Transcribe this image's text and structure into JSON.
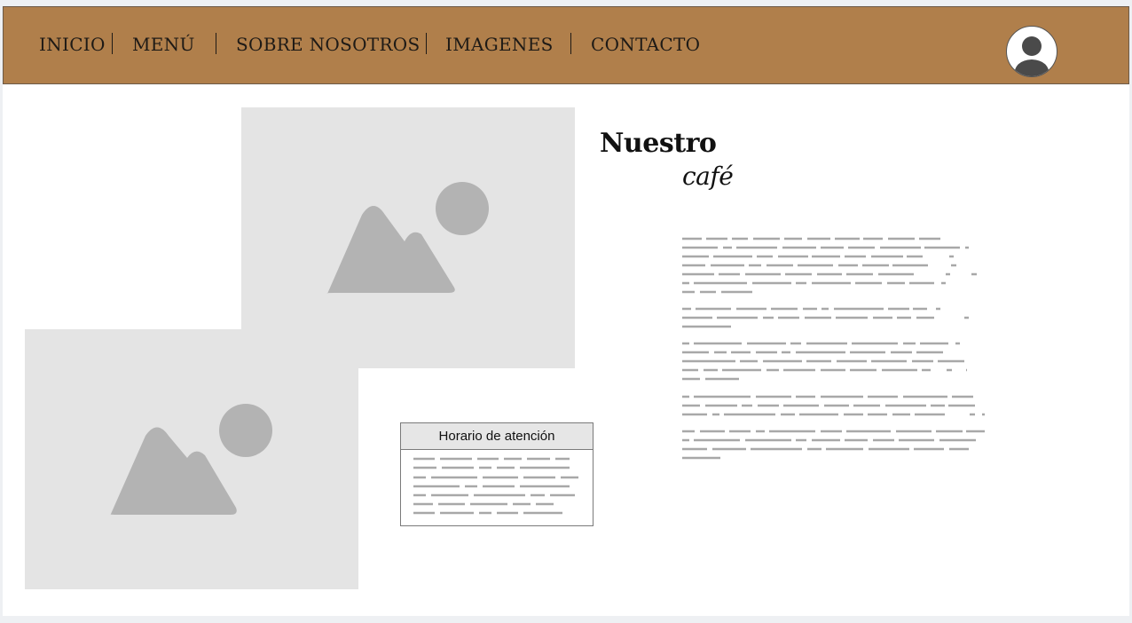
{
  "nav": {
    "items": [
      {
        "label": "INICIO"
      },
      {
        "label": "MENÚ"
      },
      {
        "label": "SOBRE NOSOTROS"
      },
      {
        "label": "IMAGENES"
      },
      {
        "label": "CONTACTO"
      }
    ],
    "background_color": "#b07f4b"
  },
  "user": {
    "icon": "user-avatar-icon"
  },
  "images": [
    {
      "icon": "image-placeholder-icon"
    },
    {
      "icon": "image-placeholder-icon"
    }
  ],
  "hero": {
    "title_line1": "Nuestro",
    "title_line2": "café"
  },
  "hours": {
    "title": "Horario de atención"
  },
  "colors": {
    "placeholder_bg": "#e4e4e4",
    "placeholder_shape": "#b3b3b3",
    "text_placeholder": "#a8a8a8"
  }
}
